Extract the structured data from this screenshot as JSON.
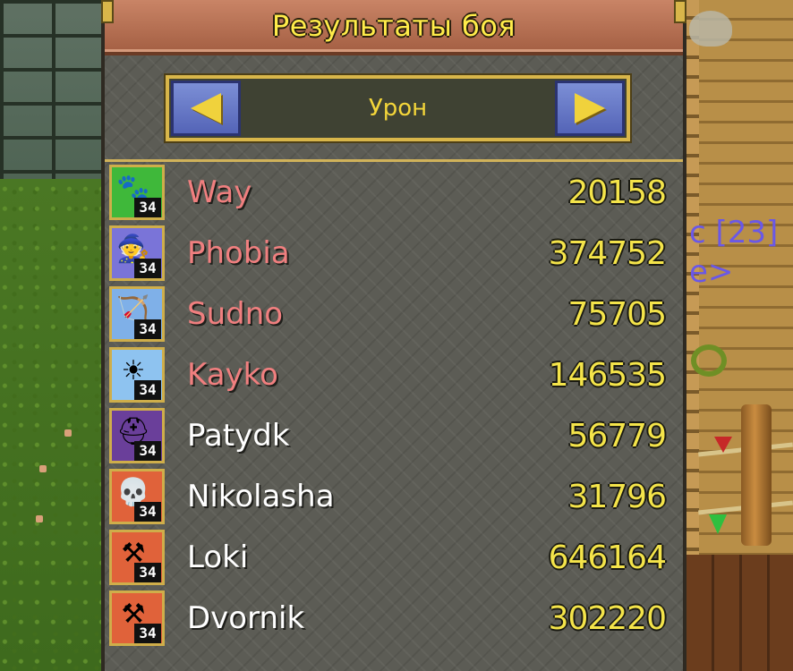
{
  "window": {
    "title": "Результаты боя"
  },
  "selector": {
    "label": "Урон"
  },
  "background_text": {
    "line1": "c [23]",
    "line2": "e>"
  },
  "colors": {
    "title_bar": "#b56f52",
    "title_text": "#ffec4a",
    "value_text": "#f4e44a",
    "name_enemy": "#f07f7f",
    "name_ally": "#ffffff",
    "arrow_button": "#6677c9"
  },
  "players": [
    {
      "name": "Way",
      "value": "20158",
      "level": "34",
      "team": "red",
      "icon": "paw-icon",
      "icon_bg": "#3fb83a",
      "glyph": "🐾"
    },
    {
      "name": "Phobia",
      "value": "374752",
      "level": "34",
      "team": "red",
      "icon": "wizard-hat-icon",
      "icon_bg": "#7a74d8",
      "glyph": "🧙"
    },
    {
      "name": "Sudno",
      "value": "75705",
      "level": "34",
      "team": "red",
      "icon": "bow-icon",
      "icon_bg": "#7fb0e8",
      "glyph": "🏹"
    },
    {
      "name": "Kayko",
      "value": "146535",
      "level": "34",
      "team": "red",
      "icon": "sun-icon",
      "icon_bg": "#8ec3f0",
      "glyph": "☀"
    },
    {
      "name": "Patydk",
      "value": "56779",
      "level": "34",
      "team": "white",
      "icon": "helmet-icon",
      "icon_bg": "#6a3f9a",
      "glyph": "⛑"
    },
    {
      "name": "Nikolasha",
      "value": "31796",
      "level": "34",
      "team": "white",
      "icon": "skull-icon",
      "icon_bg": "#e0623a",
      "glyph": "💀"
    },
    {
      "name": "Loki",
      "value": "646164",
      "level": "34",
      "team": "white",
      "icon": "mace-icon",
      "icon_bg": "#e0623a",
      "glyph": "⚒"
    },
    {
      "name": "Dvornik",
      "value": "302220",
      "level": "34",
      "team": "white",
      "icon": "mace-icon",
      "icon_bg": "#e0623a",
      "glyph": "⚒"
    }
  ]
}
